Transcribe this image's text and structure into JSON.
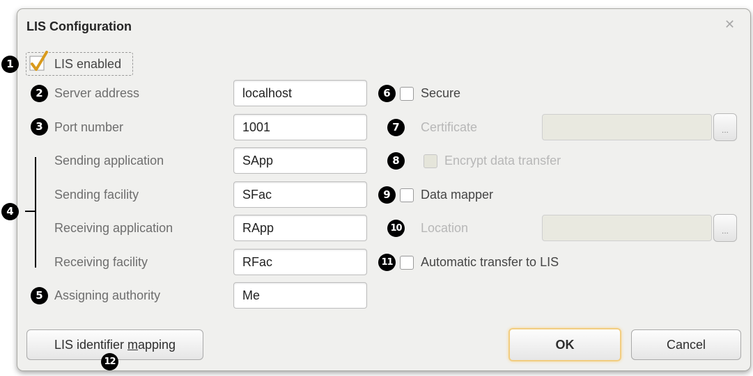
{
  "dialog": {
    "title": "LIS Configuration"
  },
  "lis_enabled": {
    "label": "LIS enabled",
    "checked": true
  },
  "left_fields": [
    {
      "label": "Server address",
      "value": "localhost"
    },
    {
      "label": "Port number",
      "value": "1001"
    },
    {
      "label": "Sending application",
      "value": "SApp"
    },
    {
      "label": "Sending facility",
      "value": "SFac"
    },
    {
      "label": "Receiving application",
      "value": "RApp"
    },
    {
      "label": "Receiving facility",
      "value": "RFac"
    },
    {
      "label": "Assigning authority",
      "value": "Me"
    }
  ],
  "right_options": {
    "secure": {
      "label": "Secure",
      "checked": false
    },
    "certificate": {
      "label": "Certificate",
      "value": "",
      "browse": "..."
    },
    "encrypt": {
      "label": "Encrypt data transfer",
      "checked": false
    },
    "data_mapper": {
      "label": "Data mapper",
      "checked": false
    },
    "location": {
      "label": "Location",
      "value": "",
      "browse": "..."
    },
    "auto_transfer": {
      "label": "Automatic transfer to LIS",
      "checked": false
    }
  },
  "buttons": {
    "mapping_prefix": "LIS identifier ",
    "mapping_underlined": "m",
    "mapping_suffix": "apping",
    "ok": "OK",
    "cancel": "Cancel"
  },
  "callouts": [
    "1",
    "2",
    "3",
    "4",
    "5",
    "6",
    "7",
    "8",
    "9",
    "10",
    "11",
    "12"
  ],
  "colors": {
    "checkmark": "#d99a1c",
    "ok_glow": "#f2cd80"
  },
  "icons": {
    "close": "close-icon",
    "check": "checkmark-icon"
  }
}
